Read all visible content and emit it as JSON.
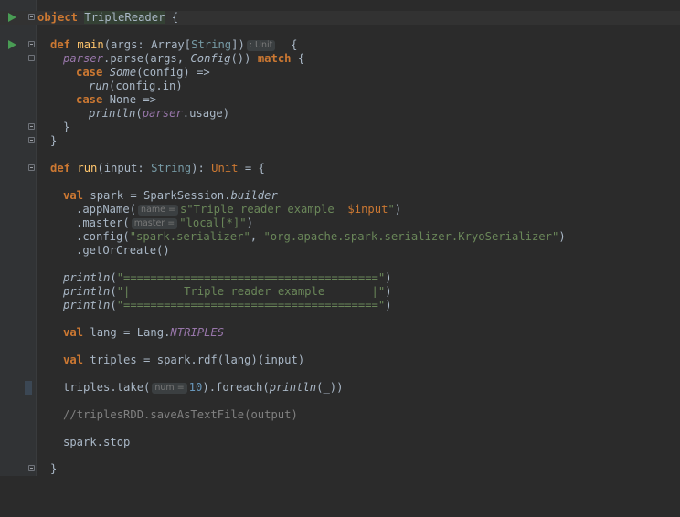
{
  "editor": {
    "line1": {
      "kw": "object",
      "name": "TripleReader",
      "rest": " {"
    },
    "line2": {
      "kw_def": "def ",
      "main": "main",
      "p1": "(args: Array[",
      "type": "String",
      "p2": "])",
      "hint": ": Unit",
      "p3": "  {"
    },
    "line3": {
      "parser": "parser",
      "p1": ".parse(args, ",
      "config": "Config",
      "p2": "()) ",
      "kw": "match",
      "p3": " {"
    },
    "line4": {
      "kw": "case",
      "some": "Some",
      "rest": "(config) =>"
    },
    "line5": {
      "run": "run",
      "rest": "(config.in)"
    },
    "line6": {
      "kw": "case",
      "rest": " None =>"
    },
    "line7": {
      "fn": "println",
      "p1": "(",
      "parser": "parser",
      "p2": ".usage)"
    },
    "line8": {
      "text": "}"
    },
    "line9": {
      "text": "}"
    },
    "line10": {
      "kw": "def ",
      "run": "run",
      "p1": "(input: ",
      "type": "String",
      "p2": "): ",
      "unit": "Unit",
      "p3": " = {"
    },
    "line11": {
      "kw": "val",
      "p1": " spark = SparkSession.",
      "builder": "builder"
    },
    "line12": {
      "p1": ".appName(",
      "hint": "name =",
      "s1": "s\"Triple reader example  ",
      "interp": "$input",
      "s2": "\"",
      "p2": ")"
    },
    "line13": {
      "p1": ".master(",
      "hint": "master =",
      "s": "\"local[*]\"",
      "p2": ")"
    },
    "line14": {
      "p1": ".config(",
      "s1": "\"spark.serializer\"",
      "p2": ", ",
      "s2": "\"org.apache.spark.serializer.KryoSerializer\"",
      "p3": ")"
    },
    "line15": {
      "text": ".getOrCreate()"
    },
    "line16": {
      "fn": "println",
      "p1": "(",
      "s": "\"======================================\"",
      "p2": ")"
    },
    "line17": {
      "fn": "println",
      "p1": "(",
      "s": "\"|        Triple reader example       |\"",
      "p2": ")"
    },
    "line18": {
      "fn": "println",
      "p1": "(",
      "s": "\"======================================\"",
      "p2": ")"
    },
    "line19": {
      "kw": "val",
      "p1": " lang = Lang.",
      "ntriples": "NTRIPLES"
    },
    "line20": {
      "kw": "val",
      "p1": " triples = spark.rdf(lang)(input)"
    },
    "line21": {
      "p1": "triples.take(",
      "hint": "num =",
      "num": "10",
      "p2": ").foreach(",
      "fn": "println",
      "p3": "(_))"
    },
    "line22": {
      "text": "//triplesRDD.saveAsTextFile(output)"
    },
    "line23": {
      "text": "spark.stop"
    },
    "line24": {
      "text": "}"
    }
  },
  "colors": {
    "background": "#2b2b2b",
    "keyword": "#cc7832",
    "string": "#6a8759",
    "number": "#6897bb",
    "comment": "#808080",
    "type": "#769aa5",
    "field": "#9876aa",
    "text": "#a9b7c6"
  }
}
